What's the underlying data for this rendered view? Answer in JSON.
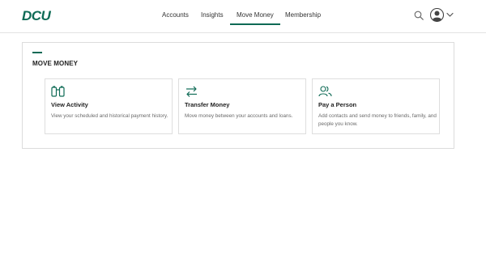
{
  "brand": {
    "logo_text": "DCU",
    "accent": "#0e6a55"
  },
  "nav": {
    "items": [
      {
        "label": "Accounts"
      },
      {
        "label": "Insights"
      },
      {
        "label": "Move Money",
        "active": true
      },
      {
        "label": "Membership"
      }
    ]
  },
  "header_icons": [
    "search-icon",
    "avatar-icon",
    "chevron-down-icon"
  ],
  "section": {
    "title": "MOVE MONEY",
    "cards": [
      {
        "icon": "binoculars-icon",
        "title": "View Activity",
        "description": "View your scheduled and historical payment history."
      },
      {
        "icon": "transfer-arrows-icon",
        "title": "Transfer Money",
        "description": "Move money between your accounts and loans."
      },
      {
        "icon": "people-icon",
        "title": "Pay a Person",
        "description": "Add contacts and send money to friends, family, and people you know."
      }
    ]
  }
}
